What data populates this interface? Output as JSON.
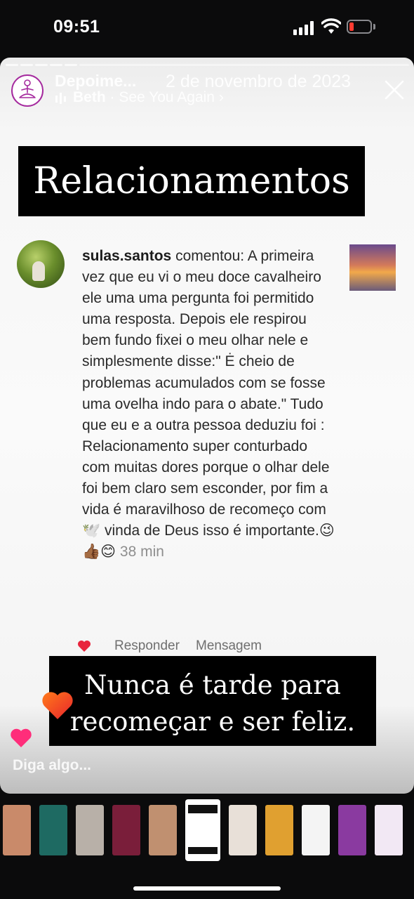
{
  "status_bar": {
    "time": "09:51",
    "battery_color": "#ff3b30"
  },
  "story": {
    "account_name": "Depoime...",
    "date": "2 de novembro de 2023",
    "music": {
      "artist": "Beth",
      "separator": " · ",
      "song": "See You Again",
      "chevron": "›"
    },
    "close_icon": "close-icon",
    "title": "Relacionamentos",
    "comment": {
      "username": "sulas.santos",
      "text": " comentou: A primeira vez que eu vi o meu doce cavalheiro ele uma uma pergunta foi permitido uma resposta. Depois ele respirou bem fundo fixei o meu olhar nele e simplesmente disse:\" Ė cheio de problemas acumulados com se fosse uma ovelha indo para o abate.\" Tudo  que eu e a outra pessoa deduziu foi :  Relacionamento super conturbado com muitas dores porque o olhar dele foi bem claro sem esconder, por fim a vida é maravilhoso de recomeço com 🕊️ vinda de Deus isso é importante.😉👍🏾😊",
      "time": "38 min",
      "reply_label": "Responder",
      "message_label": "Mensagem"
    },
    "quote": {
      "line1": "Nunca é tarde para",
      "line2": "recomeçar e ser feliz."
    },
    "reply_placeholder": "Diga algo...",
    "accent_color": "#a52a9e"
  },
  "thumbnails": [
    {
      "name": "story-1",
      "color": "#c98a6a"
    },
    {
      "name": "story-2",
      "color": "#1e6a62"
    },
    {
      "name": "story-3",
      "color": "#b8b0a8"
    },
    {
      "name": "story-4",
      "color": "#7a1e3a"
    },
    {
      "name": "story-5",
      "color": "#c09070"
    },
    {
      "name": "story-6-active",
      "color": "#ffffff"
    },
    {
      "name": "story-7",
      "color": "#e8e0d8"
    },
    {
      "name": "story-8",
      "color": "#e0a030"
    },
    {
      "name": "story-9",
      "color": "#f4f4f4"
    },
    {
      "name": "story-10",
      "color": "#8a3aa0"
    },
    {
      "name": "story-11",
      "color": "#f2e8f4"
    }
  ]
}
